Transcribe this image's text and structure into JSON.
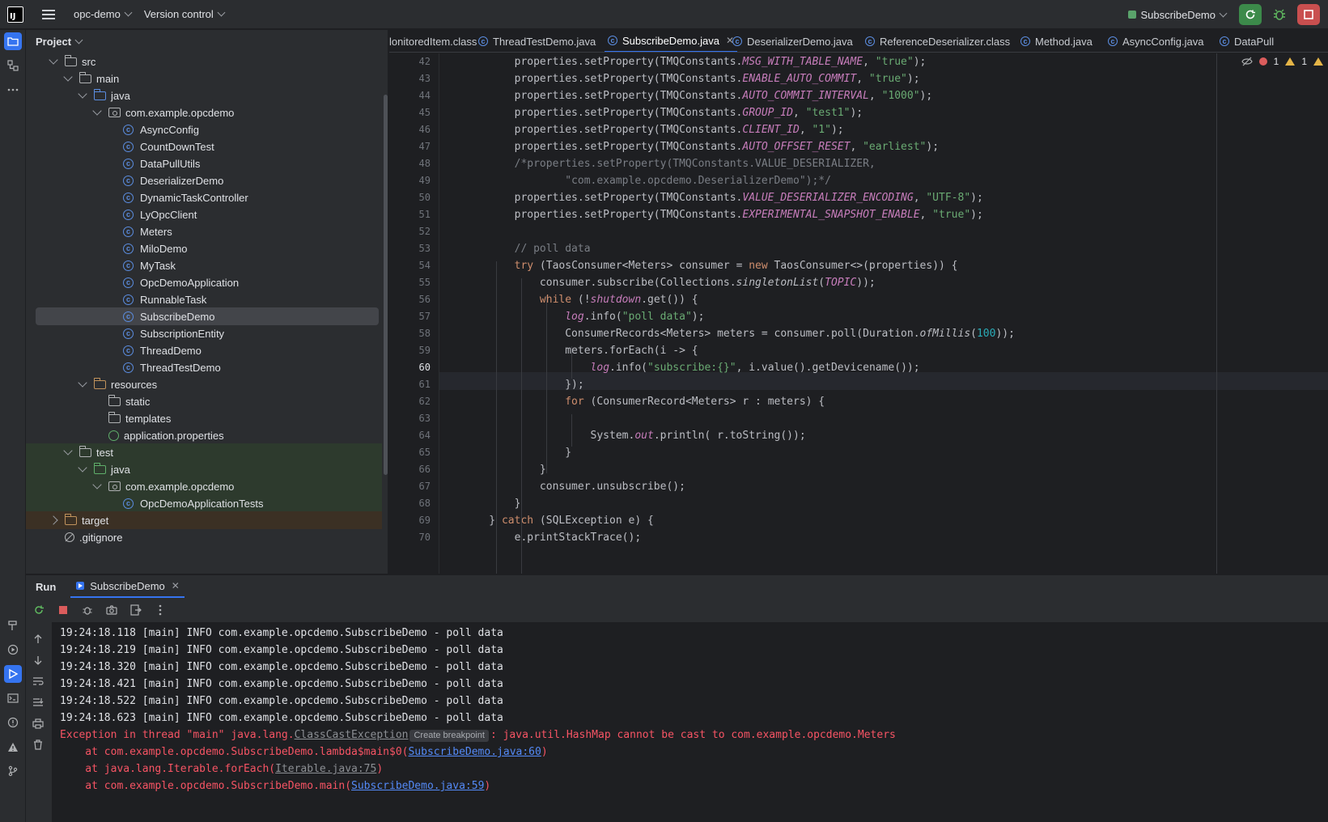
{
  "titlebar": {
    "project_name": "opc-demo",
    "vcs_label": "Version control",
    "run_config": "SubscribeDemo"
  },
  "project_panel": {
    "title": "Project",
    "tree": [
      {
        "label": "src",
        "type": "folder",
        "indent": 1,
        "expanded": true
      },
      {
        "label": "main",
        "type": "folder",
        "indent": 2,
        "expanded": true
      },
      {
        "label": "java",
        "type": "folder-blue",
        "indent": 3,
        "expanded": true
      },
      {
        "label": "com.example.opcdemo",
        "type": "package",
        "indent": 4,
        "expanded": true
      },
      {
        "label": "AsyncConfig",
        "type": "class",
        "indent": 5
      },
      {
        "label": "CountDownTest",
        "type": "class",
        "indent": 5
      },
      {
        "label": "DataPullUtils",
        "type": "class",
        "indent": 5
      },
      {
        "label": "DeserializerDemo",
        "type": "class",
        "indent": 5
      },
      {
        "label": "DynamicTaskController",
        "type": "class",
        "indent": 5
      },
      {
        "label": "LyOpcClient",
        "type": "class",
        "indent": 5
      },
      {
        "label": "Meters",
        "type": "class",
        "indent": 5
      },
      {
        "label": "MiloDemo",
        "type": "class",
        "indent": 5
      },
      {
        "label": "MyTask",
        "type": "class",
        "indent": 5
      },
      {
        "label": "OpcDemoApplication",
        "type": "class",
        "indent": 5
      },
      {
        "label": "RunnableTask",
        "type": "class",
        "indent": 5
      },
      {
        "label": "SubscribeDemo",
        "type": "class",
        "indent": 5,
        "selected": true
      },
      {
        "label": "SubscriptionEntity",
        "type": "class",
        "indent": 5
      },
      {
        "label": "ThreadDemo",
        "type": "class",
        "indent": 5
      },
      {
        "label": "ThreadTestDemo",
        "type": "class",
        "indent": 5
      },
      {
        "label": "resources",
        "type": "folder-res",
        "indent": 3,
        "expanded": true
      },
      {
        "label": "static",
        "type": "folder",
        "indent": 4
      },
      {
        "label": "templates",
        "type": "folder",
        "indent": 4
      },
      {
        "label": "application.properties",
        "type": "properties",
        "indent": 4
      },
      {
        "label": "test",
        "type": "folder",
        "indent": 2,
        "expanded": true,
        "bg": "test"
      },
      {
        "label": "java",
        "type": "folder-green",
        "indent": 3,
        "expanded": true,
        "bg": "test"
      },
      {
        "label": "com.example.opcdemo",
        "type": "package",
        "indent": 4,
        "expanded": true,
        "bg": "test"
      },
      {
        "label": "OpcDemoApplicationTests",
        "type": "class",
        "indent": 5,
        "bg": "test"
      },
      {
        "label": "target",
        "type": "folder-orange",
        "indent": 1,
        "expanded": false,
        "bg": "target"
      },
      {
        "label": ".gitignore",
        "type": "ignore",
        "indent": 1
      }
    ]
  },
  "editor_tabs": [
    {
      "label": "lonitoredItem.class",
      "active": false,
      "icon": false
    },
    {
      "label": "ThreadTestDemo.java",
      "active": false,
      "icon": true
    },
    {
      "label": "SubscribeDemo.java",
      "active": true,
      "icon": true
    },
    {
      "label": "DeserializerDemo.java",
      "active": false,
      "icon": true
    },
    {
      "label": "ReferenceDeserializer.class",
      "active": false,
      "icon": true
    },
    {
      "label": "Method.java",
      "active": false,
      "icon": true
    },
    {
      "label": "AsyncConfig.java",
      "active": false,
      "icon": true
    },
    {
      "label": "DataPull",
      "active": false,
      "icon": true
    }
  ],
  "inspections": {
    "errors": "1",
    "warnings": "1"
  },
  "editor": {
    "current_line": "60",
    "line_numbers": [
      "42",
      "43",
      "44",
      "45",
      "46",
      "47",
      "48",
      "49",
      "50",
      "51",
      "52",
      "53",
      "54",
      "55",
      "56",
      "57",
      "58",
      "59",
      "60",
      "61",
      "62",
      "63",
      "64",
      "65",
      "66",
      "67",
      "68",
      "69",
      "70"
    ],
    "lines": [
      [
        [
          "        properties.setProperty(TMQConstants.",
          ""
        ],
        [
          "MSG_WITH_TABLE_NAME",
          "it"
        ],
        [
          ", ",
          ""
        ],
        [
          "\"true\"",
          "str"
        ],
        [
          ");",
          ""
        ]
      ],
      [
        [
          "        properties.setProperty(TMQConstants.",
          ""
        ],
        [
          "ENABLE_AUTO_COMMIT",
          "it"
        ],
        [
          ", ",
          ""
        ],
        [
          "\"true\"",
          "str"
        ],
        [
          ");",
          ""
        ]
      ],
      [
        [
          "        properties.setProperty(TMQConstants.",
          ""
        ],
        [
          "AUTO_COMMIT_INTERVAL",
          "it"
        ],
        [
          ", ",
          ""
        ],
        [
          "\"1000\"",
          "str"
        ],
        [
          ");",
          ""
        ]
      ],
      [
        [
          "        properties.setProperty(TMQConstants.",
          ""
        ],
        [
          "GROUP_ID",
          "it"
        ],
        [
          ", ",
          ""
        ],
        [
          "\"test1\"",
          "str"
        ],
        [
          ");",
          ""
        ]
      ],
      [
        [
          "        properties.setProperty(TMQConstants.",
          ""
        ],
        [
          "CLIENT_ID",
          "it"
        ],
        [
          ", ",
          ""
        ],
        [
          "\"1\"",
          "str"
        ],
        [
          ");",
          ""
        ]
      ],
      [
        [
          "        properties.setProperty(TMQConstants.",
          ""
        ],
        [
          "AUTO_OFFSET_RESET",
          "it"
        ],
        [
          ", ",
          ""
        ],
        [
          "\"earliest\"",
          "str"
        ],
        [
          ");",
          ""
        ]
      ],
      [
        [
          "        /*properties.setProperty(TMQConstants.VALUE_DESERIALIZER,",
          "cm"
        ]
      ],
      [
        [
          "                \"com.example.opcdemo.DeserializerDemo\");*/",
          "cm"
        ]
      ],
      [
        [
          "        properties.setProperty(TMQConstants.",
          ""
        ],
        [
          "VALUE_DESERIALIZER_ENCODING",
          "it"
        ],
        [
          ", ",
          ""
        ],
        [
          "\"UTF-8\"",
          "str"
        ],
        [
          ");",
          ""
        ]
      ],
      [
        [
          "        properties.setProperty(TMQConstants.",
          ""
        ],
        [
          "EXPERIMENTAL_SNAPSHOT_ENABLE",
          "it"
        ],
        [
          ", ",
          ""
        ],
        [
          "\"true\"",
          "str"
        ],
        [
          ");",
          ""
        ]
      ],
      [
        [
          "",
          ""
        ]
      ],
      [
        [
          "        // poll data",
          "cm"
        ]
      ],
      [
        [
          "        ",
          ""
        ],
        [
          "try",
          "kw"
        ],
        [
          " (TaosConsumer<Meters> consumer = ",
          ""
        ],
        [
          "new",
          "kw"
        ],
        [
          " TaosConsumer<>(properties)) {",
          ""
        ]
      ],
      [
        [
          "            consumer.subscribe(Collections.",
          ""
        ],
        [
          "singletonList",
          "mi"
        ],
        [
          "(",
          ""
        ],
        [
          "TOPIC",
          "it"
        ],
        [
          "));",
          ""
        ]
      ],
      [
        [
          "            ",
          ""
        ],
        [
          "while",
          "kw"
        ],
        [
          " (!",
          ""
        ],
        [
          "shutdown",
          "it"
        ],
        [
          ".get()) {",
          ""
        ]
      ],
      [
        [
          "                ",
          ""
        ],
        [
          "log",
          "it"
        ],
        [
          ".info(",
          ""
        ],
        [
          "\"poll data\"",
          "str"
        ],
        [
          ");",
          ""
        ]
      ],
      [
        [
          "                ConsumerRecords<Meters> meters = consumer.poll(Duration.",
          ""
        ],
        [
          "ofMillis",
          "mi"
        ],
        [
          "(",
          ""
        ],
        [
          "100",
          "num"
        ],
        [
          "));",
          ""
        ]
      ],
      [
        [
          "                meters.forEach(i -> {",
          ""
        ]
      ],
      [
        [
          "                    ",
          ""
        ],
        [
          "log",
          "it"
        ],
        [
          ".info(",
          ""
        ],
        [
          "\"subscribe:{}\"",
          "str"
        ],
        [
          ", i.value().getDevicename());",
          ""
        ]
      ],
      [
        [
          "                });",
          ""
        ]
      ],
      [
        [
          "                ",
          ""
        ],
        [
          "for",
          "kw"
        ],
        [
          " (ConsumerRecord<Meters> r : meters) {",
          ""
        ]
      ],
      [
        [
          "",
          ""
        ]
      ],
      [
        [
          "                    System.",
          ""
        ],
        [
          "out",
          "it"
        ],
        [
          ".println( r.toString());",
          ""
        ]
      ],
      [
        [
          "                }",
          ""
        ]
      ],
      [
        [
          "            }",
          ""
        ]
      ],
      [
        [
          "            consumer.unsubscribe();",
          ""
        ]
      ],
      [
        [
          "        }",
          ""
        ]
      ],
      [
        [
          "    } ",
          ""
        ],
        [
          "catch",
          "kw"
        ],
        [
          " (SQLException e) {",
          ""
        ]
      ],
      [
        [
          "        e.printStackTrace();",
          ""
        ]
      ]
    ]
  },
  "run_panel": {
    "title": "Run",
    "tab_label": "SubscribeDemo",
    "console": {
      "info_lines": [
        "19:24:18.118 [main] INFO com.example.opcdemo.SubscribeDemo - poll data",
        "19:24:18.219 [main] INFO com.example.opcdemo.SubscribeDemo - poll data",
        "19:24:18.320 [main] INFO com.example.opcdemo.SubscribeDemo - poll data",
        "19:24:18.421 [main] INFO com.example.opcdemo.SubscribeDemo - poll data",
        "19:24:18.522 [main] INFO com.example.opcdemo.SubscribeDemo - poll data",
        "19:24:18.623 [main] INFO com.example.opcdemo.SubscribeDemo - poll data"
      ],
      "exception_prefix": "Exception in thread \"main\" java.lang.",
      "exception_class": "ClassCastException",
      "create_breakpoint": "Create breakpoint",
      "exception_message": ": java.util.HashMap cannot be cast to com.example.opcdemo.Meters",
      "stack": [
        {
          "prefix": "    at com.example.opcdemo.SubscribeDemo.lambda$main$0(",
          "link": "SubscribeDemo.java:60",
          "suffix": ")",
          "dim": false
        },
        {
          "prefix": "    at java.lang.Iterable.forEach(",
          "link": "Iterable.java:75",
          "suffix": ")",
          "dim": true
        },
        {
          "prefix": "    at com.example.opcdemo.SubscribeDemo.main(",
          "link": "SubscribeDemo.java:59",
          "suffix": ")",
          "dim": false
        }
      ]
    }
  },
  "colors": {
    "accent": "#3574f0",
    "error": "#f75464",
    "keyword": "#cf8e6d",
    "string": "#6aab73",
    "constant": "#c77dbb"
  }
}
